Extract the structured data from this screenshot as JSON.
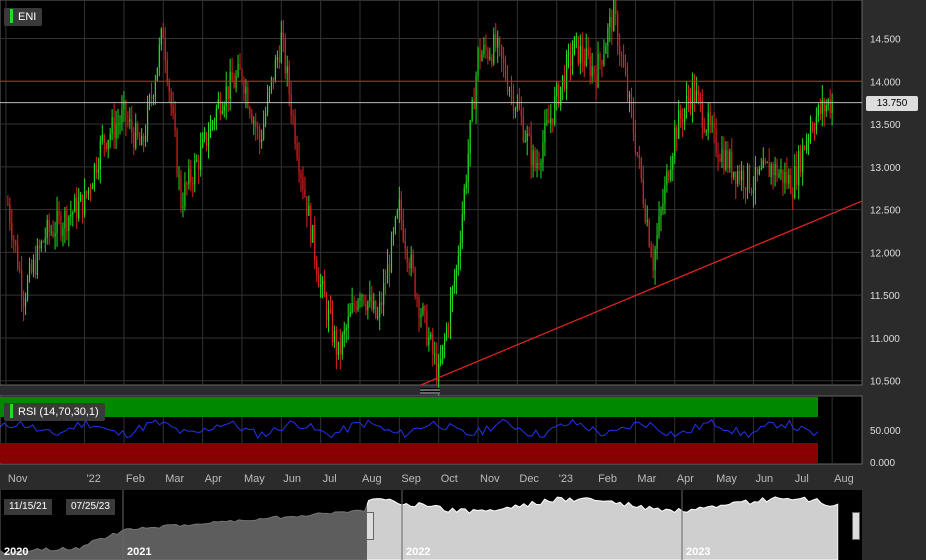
{
  "symbol": "ENI",
  "indicator_label": "RSI (14,70,30,1)",
  "current_price_label": "13.750",
  "date_range": {
    "start": "11/15/21",
    "end": "07/25/23"
  },
  "colors": {
    "up": "#22dd22",
    "down": "#dd2222",
    "rsi_line": "#2233ee",
    "overbought": "#008800",
    "oversold": "#880000",
    "hline": "#cc2222",
    "trend": "#dd2222"
  },
  "chart_data": [
    {
      "type": "candlestick",
      "title": "ENI",
      "y_ticks": [
        "14.500",
        "14.000",
        "13.500",
        "13.000",
        "12.500",
        "12.000",
        "11.500",
        "11.000",
        "10.500"
      ],
      "ylim": [
        10.45,
        14.95
      ],
      "x_ticks": [
        "Nov",
        "'22",
        "Feb",
        "Mar",
        "Apr",
        "May",
        "Jun",
        "Jul",
        "Aug",
        "Sep",
        "Oct",
        "Nov",
        "Dec",
        "'23",
        "Feb",
        "Mar",
        "Apr",
        "May",
        "Jun",
        "Jul",
        "Aug"
      ],
      "horizontal_line": 14.0,
      "last_price": 13.75,
      "trendline": [
        {
          "x": "Sep 2022",
          "y": 10.45
        },
        {
          "x": "Aug 2023",
          "y": 12.6
        }
      ],
      "price_path": [
        [
          "Nov 2021",
          12.7
        ],
        [
          "Nov 2021",
          11.5
        ],
        [
          "Dec 2021",
          12.2
        ],
        [
          "Jan 2022",
          12.6
        ],
        [
          "Jan 2022",
          13.3
        ],
        [
          "Feb 2022",
          13.6
        ],
        [
          "Feb 2022",
          13.2
        ],
        [
          "Mar 2022",
          14.6
        ],
        [
          "Mar 2022",
          12.6
        ],
        [
          "Apr 2022",
          13.2
        ],
        [
          "Apr 2022",
          13.8
        ],
        [
          "May 2022",
          14.1
        ],
        [
          "May 2022",
          13.3
        ],
        [
          "Jun 2022",
          14.5
        ],
        [
          "Jun 2022",
          13.1
        ],
        [
          "Jul 2022",
          11.6
        ],
        [
          "Jul 2022",
          10.8
        ],
        [
          "Aug 2022",
          11.6
        ],
        [
          "Aug 2022",
          11.2
        ],
        [
          "Sep 2022",
          12.5
        ],
        [
          "Sep 2022",
          11.5
        ],
        [
          "Oct 2022",
          10.55
        ],
        [
          "Oct 2022",
          11.8
        ],
        [
          "Nov 2022",
          14.3
        ],
        [
          "Nov 2022",
          14.4
        ],
        [
          "Dec 2022",
          13.7
        ],
        [
          "Dec 2022",
          13.0
        ],
        [
          "Jan 2023",
          13.8
        ],
        [
          "Jan 2023",
          14.4
        ],
        [
          "Feb 2023",
          14.1
        ],
        [
          "Feb 2023",
          14.8
        ],
        [
          "Mar 2023",
          13.3
        ],
        [
          "Mar 2023",
          11.9
        ],
        [
          "Apr 2023",
          13.4
        ],
        [
          "Apr 2023",
          13.9
        ],
        [
          "May 2023",
          13.3
        ],
        [
          "May 2023",
          13.0
        ],
        [
          "Jun 2023",
          12.8
        ],
        [
          "Jun 2023",
          13.0
        ],
        [
          "Jul 2023",
          12.8
        ],
        [
          "Jul 2023",
          13.5
        ],
        [
          "Jul 2023",
          13.75
        ]
      ]
    },
    {
      "type": "line",
      "title": "RSI (14,70,30,1)",
      "y_ticks": [
        "50.000",
        "0.000"
      ],
      "ylim": [
        0,
        100
      ],
      "overbought": 70,
      "oversold": 30
    },
    {
      "type": "area",
      "x_ticks": [
        "2020",
        "2021",
        "2022",
        "2023"
      ]
    }
  ]
}
